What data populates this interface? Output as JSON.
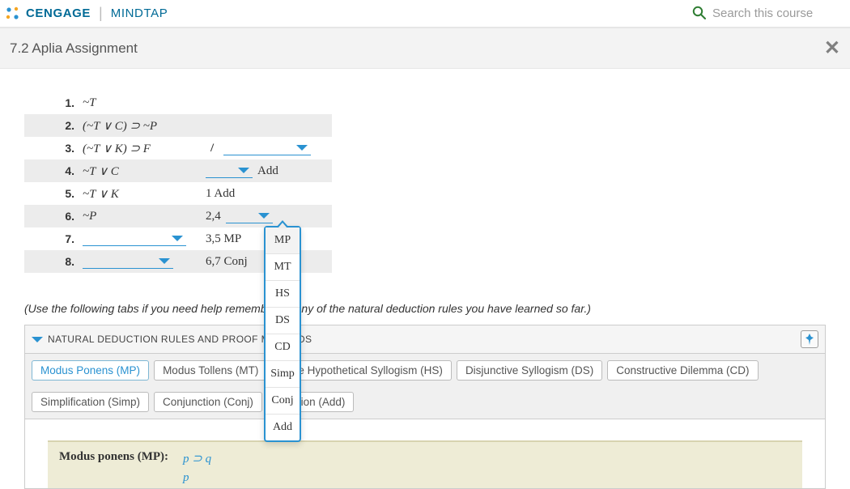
{
  "header": {
    "brand": "CENGAGE",
    "subbrand": "MINDTAP",
    "search_placeholder": "Search this course"
  },
  "titlebar": {
    "title": "7.2 Aplia Assignment"
  },
  "proof": {
    "rows": [
      {
        "n": "1.",
        "stmt_html": "~<i>T</i>"
      },
      {
        "n": "2.",
        "stmt_html": "(~<i>T</i> ∨ <i>C</i>) ⊃ ~<i>P</i>"
      },
      {
        "n": "3.",
        "stmt_html": "(~<i>T</i> ∨ <i>K</i>) ⊃ <i>F</i>"
      },
      {
        "n": "4.",
        "stmt_html": "~<i>T</i> ∨ <i>C</i>",
        "just_text": "Add"
      },
      {
        "n": "5.",
        "stmt_html": "~<i>T</i> ∨ <i>K</i>",
        "just_plain": "1 Add"
      },
      {
        "n": "6.",
        "stmt_html": "~<i>P</i>",
        "just_pre": "2,4"
      },
      {
        "n": "7.",
        "just_pre": "3,5 MP"
      },
      {
        "n": "8.",
        "just_pre": "6,7 Conj"
      }
    ],
    "slash": "/"
  },
  "rule_menu": {
    "items": [
      "MP",
      "MT",
      "HS",
      "DS",
      "CD",
      "Simp",
      "Conj",
      "Add"
    ],
    "highlight": "MP"
  },
  "hint": "(Use the following tabs if you need help remembering any of the natural deduction rules you have learned so far.)",
  "rules_panel": {
    "header": "NATURAL DEDUCTION RULES AND PROOF METHODS",
    "tabs": [
      "Modus Ponens (MP)",
      "Modus Tollens (MT)",
      "Pure Hypothetical Syllogism (HS)",
      "Disjunctive Syllogism (DS)",
      "Constructive Dilemma (CD)",
      "Simplification (Simp)",
      "Conjunction (Conj)",
      "Addition (Add)"
    ],
    "active_tab": 0,
    "rule_card": {
      "name": "Modus ponens (MP):",
      "lines": [
        "p ⊃ q",
        "p"
      ]
    }
  }
}
